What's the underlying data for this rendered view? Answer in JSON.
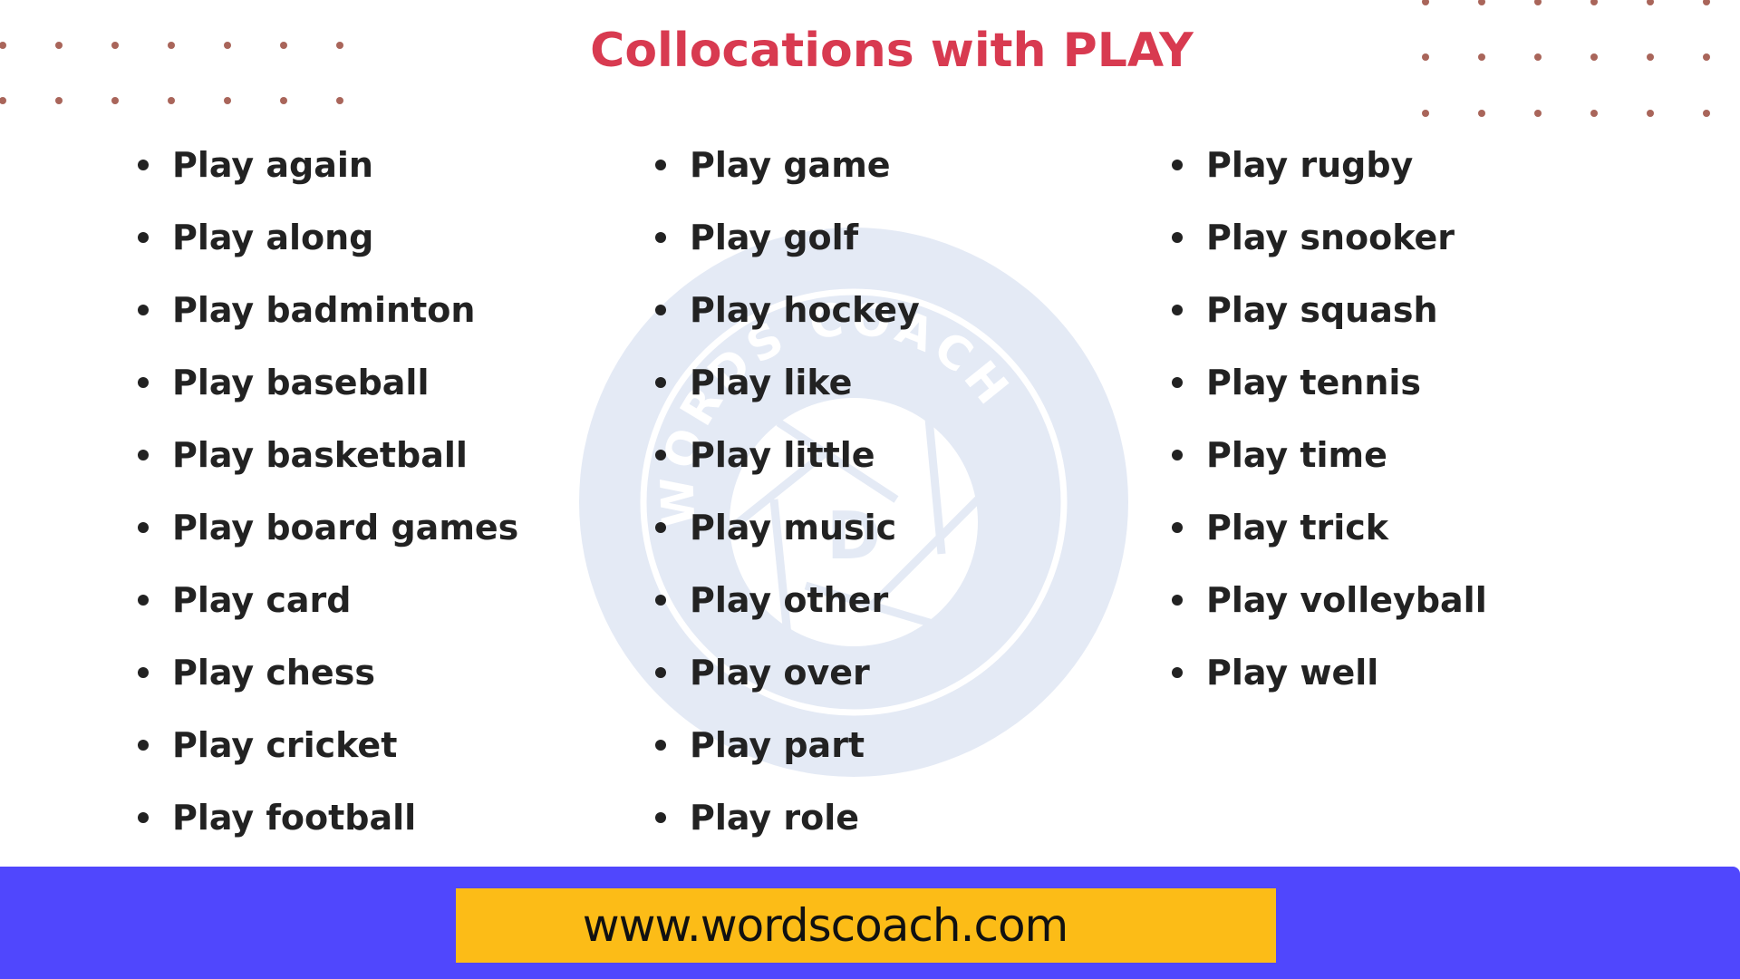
{
  "title": "Collocations with PLAY",
  "columns": [
    [
      "Play again",
      "Play along",
      "Play badminton",
      "Play baseball",
      "Play basketball",
      "Play board games",
      "Play card",
      "Play chess",
      "Play cricket",
      "Play football"
    ],
    [
      "Play game",
      "Play golf",
      "Play hockey",
      "Play like",
      "Play little",
      "Play music",
      "Play other",
      "Play over",
      "Play part",
      "Play role"
    ],
    [
      "Play rugby",
      "Play snooker",
      "Play squash",
      "Play tennis",
      "Play time",
      "Play trick",
      "Play volleyball",
      "Play well"
    ]
  ],
  "watermark": {
    "text": "WORDS COACH",
    "letter": "D",
    "icon": "aperture-logo-icon"
  },
  "footer": {
    "url": "www.wordscoach.com"
  },
  "colors": {
    "title": "#d83a50",
    "text": "#222222",
    "dots": "#a9655a",
    "footer_band": "#5047fd",
    "url_box": "#fcbc17",
    "watermark": "#e4eaf5"
  }
}
